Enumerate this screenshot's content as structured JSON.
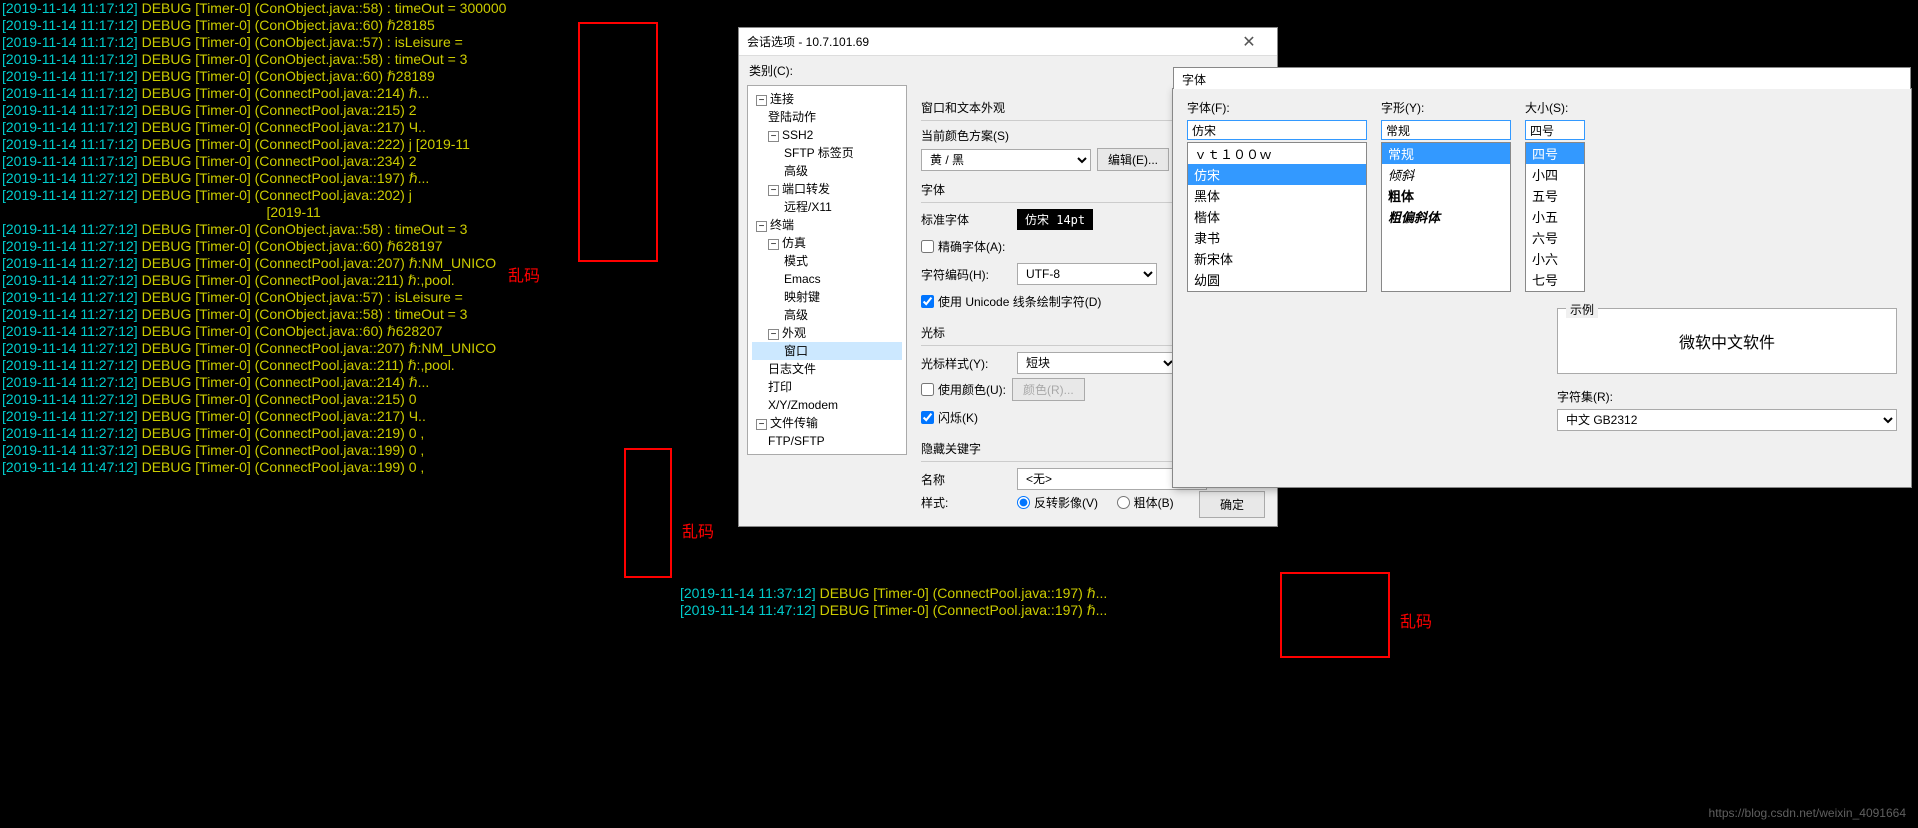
{
  "terminal_lines": [
    {
      "ts": "[2019-11-14 11:17:12]",
      "rest": " DEBUG [Timer-0] (ConObject.java::58) : timeOut = 300000"
    },
    {
      "ts": "[2019-11-14 11:17:12]",
      "rest": " DEBUG [Timer-0] (ConObject.java::60) ℏ28185"
    },
    {
      "ts": "[2019-11-14 11:17:12]",
      "rest": " DEBUG [Timer-0] (ConObject.java::57) : isLeisure ="
    },
    {
      "ts": "[2019-11-14 11:17:12]",
      "rest": " DEBUG [Timer-0] (ConObject.java::58) : timeOut = 3"
    },
    {
      "ts": "[2019-11-14 11:17:12]",
      "rest": " DEBUG [Timer-0] (ConObject.java::60) ℏ28189"
    },
    {
      "ts": "[2019-11-14 11:17:12]",
      "rest": " DEBUG [Timer-0] (ConnectPool.java::214) ℏ..."
    },
    {
      "ts": "[2019-11-14 11:17:12]",
      "rest": " DEBUG [Timer-0] (ConnectPool.java::215) 2"
    },
    {
      "ts": "[2019-11-14 11:17:12]",
      "rest": " DEBUG [Timer-0] (ConnectPool.java::217) Ч.."
    },
    {
      "ts": "[2019-11-14 11:17:12]",
      "rest": " DEBUG [Timer-0] (ConnectPool.java::222) j [2019-11"
    },
    {
      "ts": "[2019-11-14 11:17:12]",
      "rest": " DEBUG [Timer-0] (ConnectPool.java::234) 2"
    },
    {
      "ts": "[2019-11-14 11:27:12]",
      "rest": " DEBUG [Timer-0] (ConnectPool.java::197) ℏ..."
    },
    {
      "ts": "[2019-11-14 11:27:12]",
      "rest": " DEBUG [Timer-0] (ConnectPool.java::202) j"
    },
    {
      "ts": "",
      "rest": "                                                                    [2019-11"
    },
    {
      "ts": "[2019-11-14 11:27:12]",
      "rest": " DEBUG [Timer-0] (ConObject.java::58) : timeOut = 3"
    },
    {
      "ts": "[2019-11-14 11:27:12]",
      "rest": " DEBUG [Timer-0] (ConObject.java::60) ℏ628197"
    },
    {
      "ts": "[2019-11-14 11:27:12]",
      "rest": " DEBUG [Timer-0] (ConnectPool.java::207) ℏ:NM_UNICO"
    },
    {
      "ts": "[2019-11-14 11:27:12]",
      "rest": " DEBUG [Timer-0] (ConnectPool.java::211) ℏ:,pool."
    },
    {
      "ts": "[2019-11-14 11:27:12]",
      "rest": " DEBUG [Timer-0] (ConObject.java::57) : isLeisure ="
    },
    {
      "ts": "[2019-11-14 11:27:12]",
      "rest": " DEBUG [Timer-0] (ConObject.java::58) : timeOut = 3"
    },
    {
      "ts": "[2019-11-14 11:27:12]",
      "rest": " DEBUG [Timer-0] (ConObject.java::60) ℏ628207"
    },
    {
      "ts": "[2019-11-14 11:27:12]",
      "rest": " DEBUG [Timer-0] (ConnectPool.java::207) ℏ:NM_UNICO"
    },
    {
      "ts": "[2019-11-14 11:27:12]",
      "rest": " DEBUG [Timer-0] (ConnectPool.java::211) ℏ:,pool."
    },
    {
      "ts": "[2019-11-14 11:27:12]",
      "rest": " DEBUG [Timer-0] (ConnectPool.java::214) ℏ..."
    },
    {
      "ts": "[2019-11-14 11:27:12]",
      "rest": " DEBUG [Timer-0] (ConnectPool.java::215) 0"
    },
    {
      "ts": "[2019-11-14 11:27:12]",
      "rest": " DEBUG [Timer-0] (ConnectPool.java::217) Ч.."
    },
    {
      "ts": "[2019-11-14 11:27:12]",
      "rest": " DEBUG [Timer-0] (ConnectPool.java::219) 0 ,"
    },
    {
      "ts": "",
      "rest": ""
    },
    {
      "ts": "[2019-11-14 11:37:12]",
      "rest": " DEBUG [Timer-0] (ConnectPool.java::199) 0 ,"
    },
    {
      "ts": "",
      "rest": ""
    },
    {
      "ts": "[2019-11-14 11:47:12]",
      "rest": " DEBUG [Timer-0] (ConnectPool.java::199) 0 ,"
    }
  ],
  "terminal_right": [
    {
      "ts": "[2019-11-14 11:37:12]",
      "rest": " DEBUG [Timer-0] (ConnectPool.java::197) ℏ..."
    },
    {
      "ts": "",
      "rest": ""
    },
    {
      "ts": "[2019-11-14 11:47:12]",
      "rest": " DEBUG [Timer-0] (ConnectPool.java::197) ℏ..."
    }
  ],
  "red_labels": {
    "a": "乱码",
    "b": "乱码",
    "c": "乱码"
  },
  "dialog1": {
    "title": "会话选项 - 10.7.101.69",
    "category_label": "类别(C):",
    "tree": {
      "connection": "连接",
      "login": "登陆动作",
      "ssh2": "SSH2",
      "sftp": "SFTP 标签页",
      "advanced": "高级",
      "portfw": "端口转发",
      "remote": "远程/X11",
      "terminal": "终端",
      "emulation": "仿真",
      "mode": "模式",
      "emacs": "Emacs",
      "mapkey": "映射键",
      "advanced2": "高级",
      "appearance": "外观",
      "window": "窗口",
      "logfile": "日志文件",
      "print": "打印",
      "xyz": "X/Y/Zmodem",
      "filetransfer": "文件传输",
      "ftp": "FTP/SFTP"
    },
    "right": {
      "section_window": "窗口和文本外观",
      "current_scheme": "当前颜色方案(S)",
      "scheme_value": "黄 / 黑",
      "edit_btn": "编辑(E)...",
      "section_font": "字体",
      "std_font": "标准字体",
      "font_display": "仿宋 14pt",
      "precise_font": "精确字体(A):",
      "char_encoding": "字符编码(H):",
      "encoding_value": "UTF-8",
      "use_unicode": "使用 Unicode 线条绘制字符(D)",
      "section_cursor": "光标",
      "cursor_style": "光标样式(Y):",
      "cursor_value": "短块",
      "use_color": "使用颜色(U):",
      "color_btn": "颜色(R)...",
      "blink": "闪烁(K)",
      "section_hidden": "隐藏关键字",
      "name": "名称",
      "name_value": "<无>",
      "style": "样式:",
      "invert": "反转影像(V)",
      "bold": "粗体(B)",
      "ok": "确定"
    }
  },
  "dialog2": {
    "title": "字体",
    "font_label": "字体(F):",
    "font_value": "仿宋",
    "style_label": "字形(Y):",
    "style_value": "常规",
    "size_label": "大小(S):",
    "size_value": "四号",
    "fonts": [
      "ｖｔ１００ｗ",
      "仿宋",
      "黑体",
      "楷体",
      "隶书",
      "新宋体",
      "幼圆"
    ],
    "styles": [
      "常规",
      "倾斜",
      "粗体",
      "粗偏斜体"
    ],
    "sizes": [
      "四号",
      "小四",
      "五号",
      "小五",
      "六号",
      "小六",
      "七号"
    ],
    "sample_label": "示例",
    "sample_text": "微软中文软件",
    "charset_label": "字符集(R):",
    "charset_value": "中文 GB2312"
  },
  "watermark": "https://blog.csdn.net/weixin_4091664"
}
